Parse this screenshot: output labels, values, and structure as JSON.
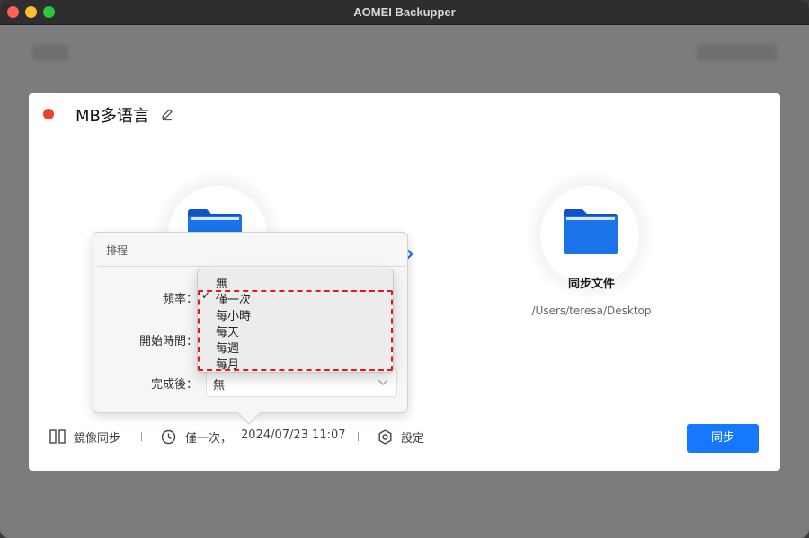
{
  "window": {
    "title": "AOMEI Backupper"
  },
  "task": {
    "name": "MB多语言",
    "status_color": "#f0402b"
  },
  "destination": {
    "label": "同步文件",
    "path": "/Users/teresa/Desktop"
  },
  "bottom_bar": {
    "mode_label": "鏡像同步",
    "schedule_label": "僅一次，",
    "schedule_time": "2024/07/23 11:07",
    "settings_label": "設定",
    "sync_button": "同步"
  },
  "schedule_popover": {
    "title": "排程",
    "frequency_label": "頻率：",
    "start_time_label": "開始時間：",
    "after_completion_label": "完成後：",
    "after_completion_value": "無",
    "frequency_options": [
      {
        "label": "無",
        "selected": false
      },
      {
        "label": "僅一次",
        "selected": true
      },
      {
        "label": "每小時",
        "selected": false
      },
      {
        "label": "每天",
        "selected": false
      },
      {
        "label": "每週",
        "selected": false
      },
      {
        "label": "每月",
        "selected": false
      }
    ],
    "check_mark": "✓"
  },
  "colors": {
    "accent": "#1677ff",
    "folder": "#1a73e8",
    "highlight": "#e8161b"
  }
}
